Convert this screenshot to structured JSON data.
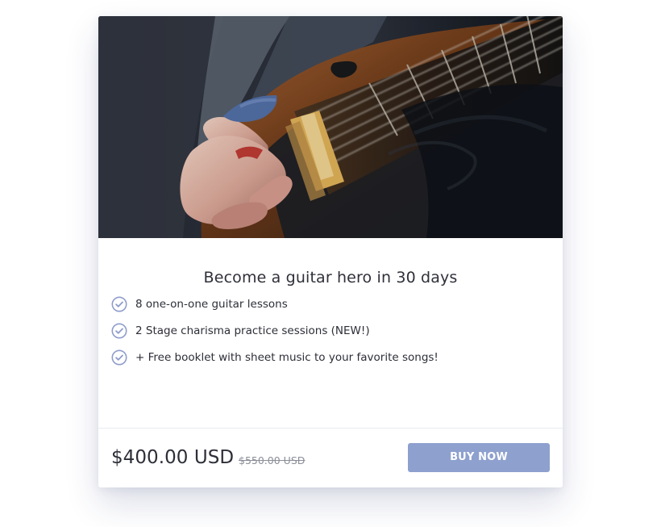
{
  "product_card": {
    "image_alt": "Close-up of a hand playing an electric guitar",
    "title": "Become a guitar hero in 30 days",
    "features": [
      {
        "text": "8 one-on-one guitar lessons",
        "icon": "check-circle-icon"
      },
      {
        "text": "2 Stage charisma practice sessions (NEW!)",
        "icon": "check-circle-icon"
      },
      {
        "text": "+ Free booklet with sheet music to your favorite songs!",
        "icon": "check-circle-icon"
      }
    ],
    "price": "$400.00 USD",
    "original_price": "$550.00 USD",
    "buy_button_label": "BUY NOW"
  },
  "colors": {
    "button": "#8ea0ce",
    "check_icon": "#8e9ccc",
    "text": "#2f3039",
    "old_price": "#8c8f99"
  }
}
